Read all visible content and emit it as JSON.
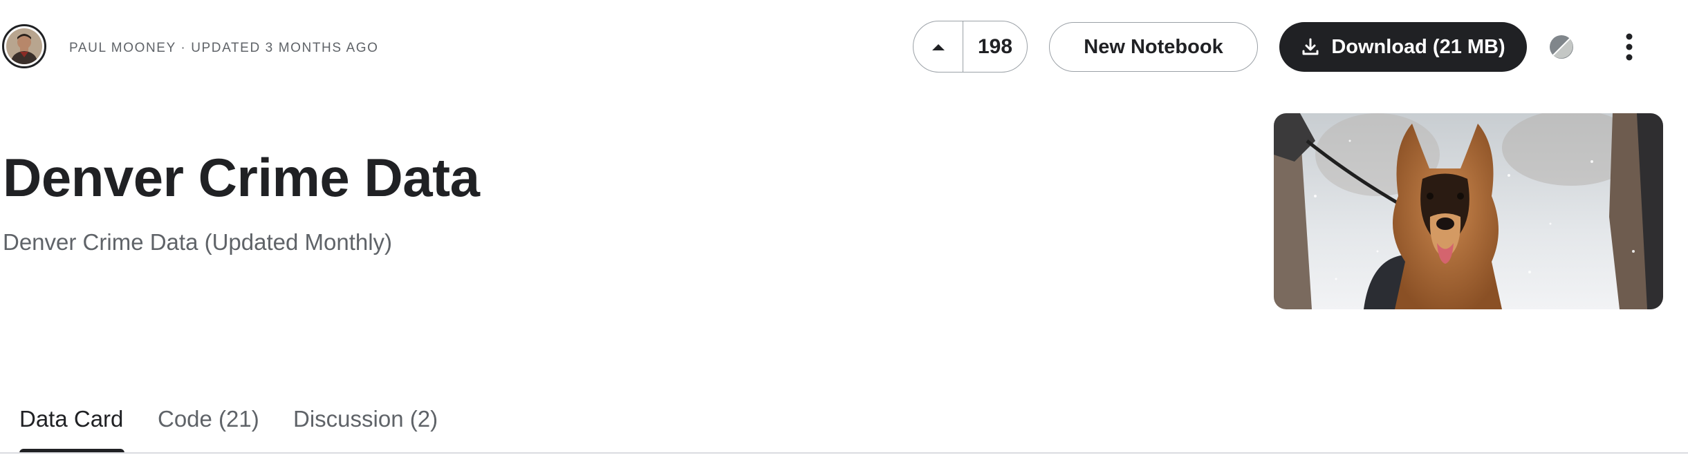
{
  "header": {
    "author": "PAUL MOONEY",
    "separator": "·",
    "updated": "UPDATED 3 MONTHS AGO",
    "meta_line": "PAUL MOONEY · UPDATED 3 MONTHS AGO",
    "avatar_icon": "user-avatar",
    "upvote_icon": "caret-up-icon",
    "vote_count": "198",
    "new_notebook_label": "New Notebook",
    "download_icon": "download-icon",
    "download_label": "Download (21 MB)",
    "theme_icon": "theme-toggle-icon",
    "more_icon": "more-vertical-icon"
  },
  "dataset": {
    "title": "Denver Crime Data",
    "subtitle": "Denver Crime Data (Updated Monthly)",
    "cover_image": "german-shepherd-in-snow"
  },
  "tabs": [
    {
      "label": "Data Card",
      "active": true
    },
    {
      "label": "Code (21)",
      "active": false
    },
    {
      "label": "Discussion (2)",
      "active": false
    }
  ],
  "colors": {
    "primary_dark": "#202124",
    "secondary_text": "#5f6368",
    "border": "#9aa0a6",
    "divider": "#dadce0"
  }
}
